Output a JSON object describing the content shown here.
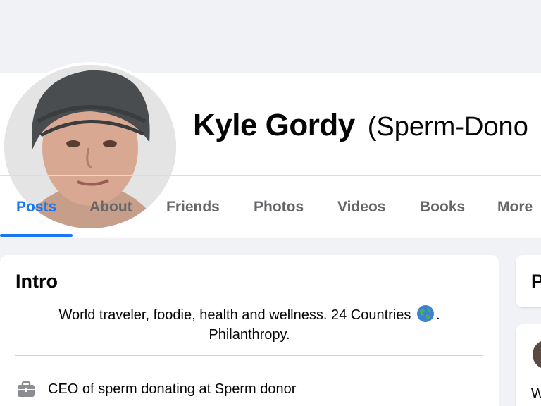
{
  "profile": {
    "name": "Kyle Gordy",
    "subtitle": "(Sperm-Dono"
  },
  "tabs": [
    {
      "label": "Posts",
      "active": true
    },
    {
      "label": "About"
    },
    {
      "label": "Friends"
    },
    {
      "label": "Photos"
    },
    {
      "label": "Videos"
    },
    {
      "label": "Books"
    },
    {
      "label": "More"
    }
  ],
  "intro": {
    "title": "Intro",
    "bio_line1": "World traveler, foodie, health and wellness. 24 Countries",
    "bio_line1_end": ".",
    "bio_line2": "Philanthropy.",
    "work": "CEO of sperm donating at Sperm donor",
    "work_icon": "briefcase-icon"
  },
  "side": {
    "card1_title": "P",
    "card2_text": "W"
  },
  "colors": {
    "accent": "#1877f2",
    "background": "#f0f2f5",
    "card": "#ffffff",
    "secondary_text": "#65676b"
  }
}
